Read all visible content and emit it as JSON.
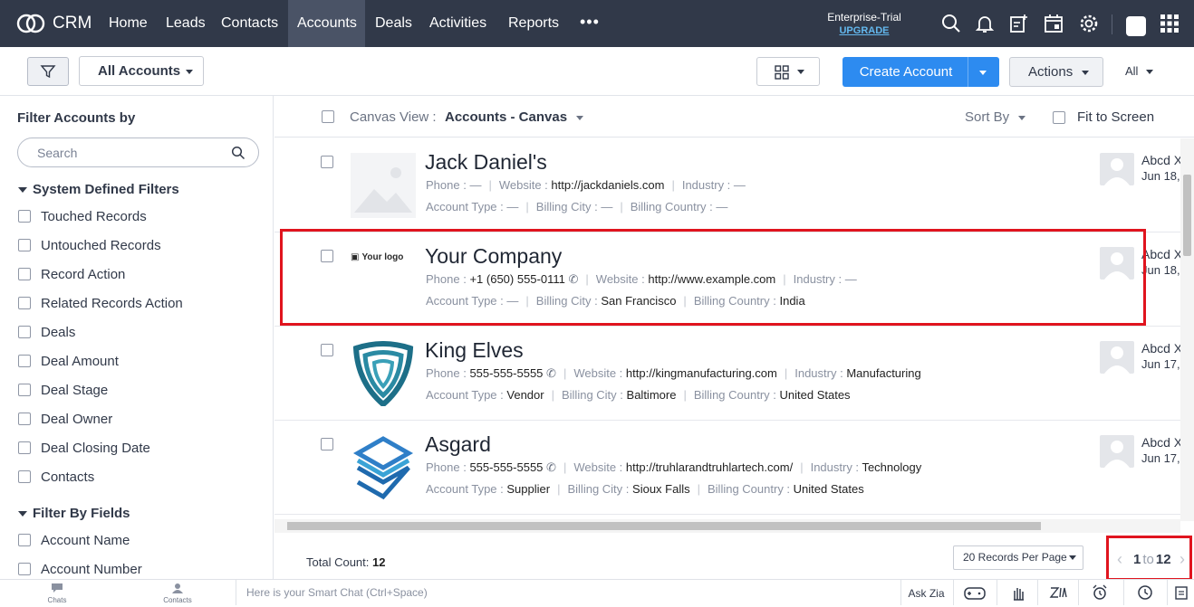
{
  "nav": {
    "app": "CRM",
    "items": [
      "Home",
      "Leads",
      "Contacts",
      "Accounts",
      "Deals",
      "Activities",
      "Reports"
    ],
    "more": "•••",
    "trial_label": "Enterprise-Trial",
    "upgrade_label": "UPGRADE"
  },
  "toolbar": {
    "view_name": "All Accounts",
    "create_label": "Create Account",
    "actions_label": "Actions",
    "all_label": "All"
  },
  "sidebar": {
    "title": "Filter Accounts by",
    "search_placeholder": "Search",
    "system_group": "System Defined Filters",
    "system_items": [
      "Touched Records",
      "Untouched Records",
      "Record Action",
      "Related Records Action",
      "Deals",
      "Deal Amount",
      "Deal Stage",
      "Deal Owner",
      "Deal Closing Date",
      "Contacts"
    ],
    "fields_group": "Filter By Fields",
    "field_items": [
      "Account Name",
      "Account Number"
    ]
  },
  "canvas": {
    "view_label": "Canvas View :",
    "view_value": "Accounts - Canvas",
    "sort_label": "Sort By",
    "fit_label": "Fit to Screen"
  },
  "field_labels": {
    "phone": "Phone :",
    "website": "Website :",
    "industry": "Industry :",
    "account_type": "Account Type :",
    "billing_city": "Billing City :",
    "billing_country": "Billing Country :"
  },
  "records": [
    {
      "name": "Jack Daniel's",
      "phone": "—",
      "website": "http://jackdaniels.com",
      "industry": "—",
      "account_type": "—",
      "billing_city": "—",
      "billing_country": "—",
      "owner": "Abcd X",
      "date": "Jun 18,"
    },
    {
      "name": "Your Company",
      "logo_text": "Your logo",
      "phone": "+1 (650) 555-0111",
      "website": "http://www.example.com",
      "industry": "—",
      "account_type": "—",
      "billing_city": "San Francisco",
      "billing_country": "India",
      "owner": "Abcd X",
      "date": "Jun 18,"
    },
    {
      "name": "King Elves",
      "phone": "555-555-5555",
      "website": "http://kingmanufacturing.com",
      "industry": "Manufacturing",
      "account_type": "Vendor",
      "billing_city": "Baltimore",
      "billing_country": "United States",
      "owner": "Abcd X",
      "date": "Jun 17,"
    },
    {
      "name": "Asgard",
      "phone": "555-555-5555",
      "website": "http://truhlarandtruhlartech.com/",
      "industry": "Technology",
      "account_type": "Supplier",
      "billing_city": "Sioux Falls",
      "billing_country": "United States",
      "owner": "Abcd X",
      "date": "Jun 17,"
    }
  ],
  "footer": {
    "total_label": "Total Count:",
    "total_value": "12",
    "per_page": "20 Records Per Page",
    "page_from": "1",
    "page_to_word": "to",
    "page_to": "12"
  },
  "bottom": {
    "chats": "Chats",
    "contacts": "Contacts",
    "smart_chat": "Here is your Smart Chat (Ctrl+Space)",
    "ask_zia": "Ask Zia"
  },
  "colors": {
    "nav_bg": "#313949",
    "accent": "#2d8bf0",
    "highlight": "#e0141e"
  }
}
